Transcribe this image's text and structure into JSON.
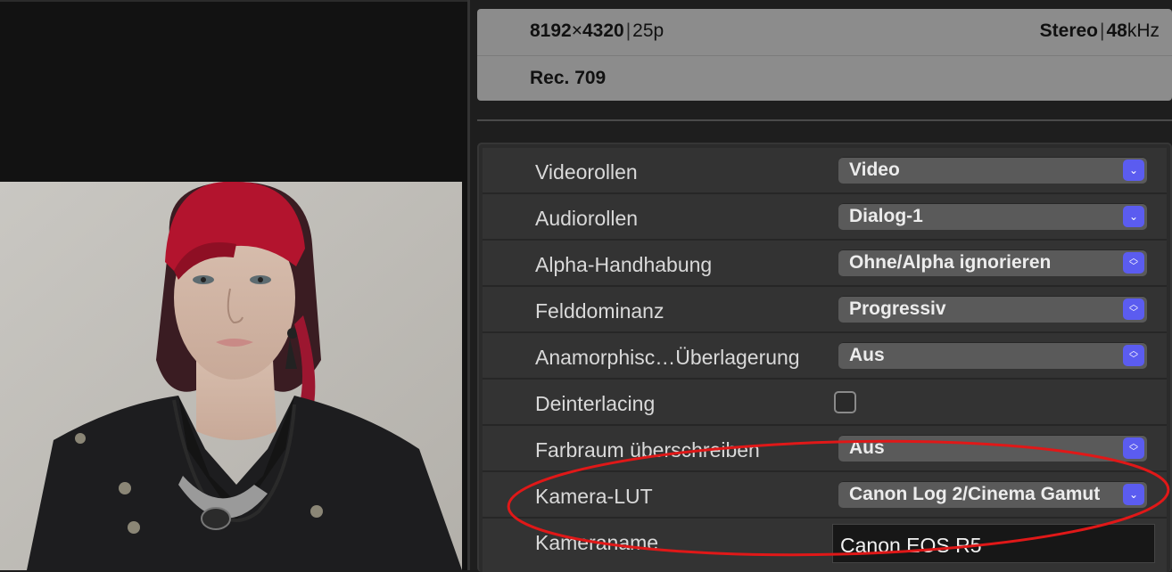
{
  "info": {
    "resolution_w": "8192",
    "times": "×",
    "resolution_h": "4320",
    "separator": "|",
    "framerate": "25p",
    "audio_channels": "Stereo",
    "audio_rate_num": "48",
    "audio_rate_unit": "kHz",
    "color_space": "Rec. 709"
  },
  "properties": [
    {
      "label": "Videorollen",
      "value": "Video",
      "control": "popup",
      "icon": "chevron-down-icon"
    },
    {
      "label": "Audiorollen",
      "value": "Dialog-1",
      "control": "popup",
      "icon": "chevron-down-icon"
    },
    {
      "label": "Alpha-Handhabung",
      "value": "Ohne/Alpha ignorieren",
      "control": "popup",
      "icon": "updown-chevron-icon"
    },
    {
      "label": "Felddominanz",
      "value": "Progressiv",
      "control": "popup",
      "icon": "updown-chevron-icon"
    },
    {
      "label": "Anamorphisc…Überlagerung",
      "value": "Aus",
      "control": "popup",
      "icon": "updown-chevron-icon"
    },
    {
      "label": "Deinterlacing",
      "control": "checkbox",
      "checked": false
    },
    {
      "label": "Farbraum überschreiben",
      "value": "Aus",
      "control": "popup",
      "icon": "updown-chevron-icon"
    },
    {
      "label": "Kamera-LUT",
      "value": "Canon Log 2/Cinema Gamut",
      "control": "popup",
      "icon": "chevron-down-icon"
    },
    {
      "label": "Kameraname",
      "value": "Canon EOS R5",
      "control": "text"
    }
  ],
  "colors": {
    "popup_accent": "#5b5cf0",
    "annotation_ellipse": "#e01818"
  }
}
